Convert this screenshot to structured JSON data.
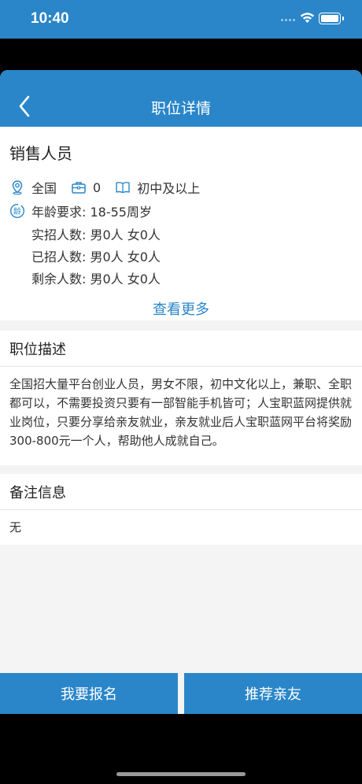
{
  "status_bar": {
    "time": "10:40",
    "signal_icon": "cellular-signal-icon",
    "wifi_icon": "wifi-icon",
    "battery_icon": "battery-icon"
  },
  "nav": {
    "title": "职位详情",
    "back_icon": "back-chevron-icon"
  },
  "job": {
    "title": "销售人员",
    "location_icon": "location-pin-icon",
    "location": "全国",
    "openings_icon": "briefcase-icon",
    "openings": "0",
    "education_icon": "book-icon",
    "education": "初中及以上",
    "age_icon": "age-badge-icon",
    "age_requirement": "年龄要求: 18-55周岁",
    "actual_hires": "实招人数: 男0人  女0人",
    "hired": "已招人数: 男0人  女0人",
    "remaining": "剩余人数: 男0人  女0人",
    "see_more": "查看更多"
  },
  "description": {
    "title": "职位描述",
    "text": "全国招大量平台创业人员，男女不限，初中文化以上，兼职、全职都可以，不需要投资只要有一部智能手机皆可；人宝职蓝网提供就业岗位，只要分享给亲友就业，亲友就业后人宝职蓝网平台将奖励300-800元一个人，帮助他人成就自己。"
  },
  "remarks": {
    "title": "备注信息",
    "text": "无"
  },
  "actions": {
    "apply": "我要报名",
    "recommend": "推荐亲友"
  },
  "colors": {
    "primary": "#2a86c9",
    "background": "#f4f4f4"
  }
}
